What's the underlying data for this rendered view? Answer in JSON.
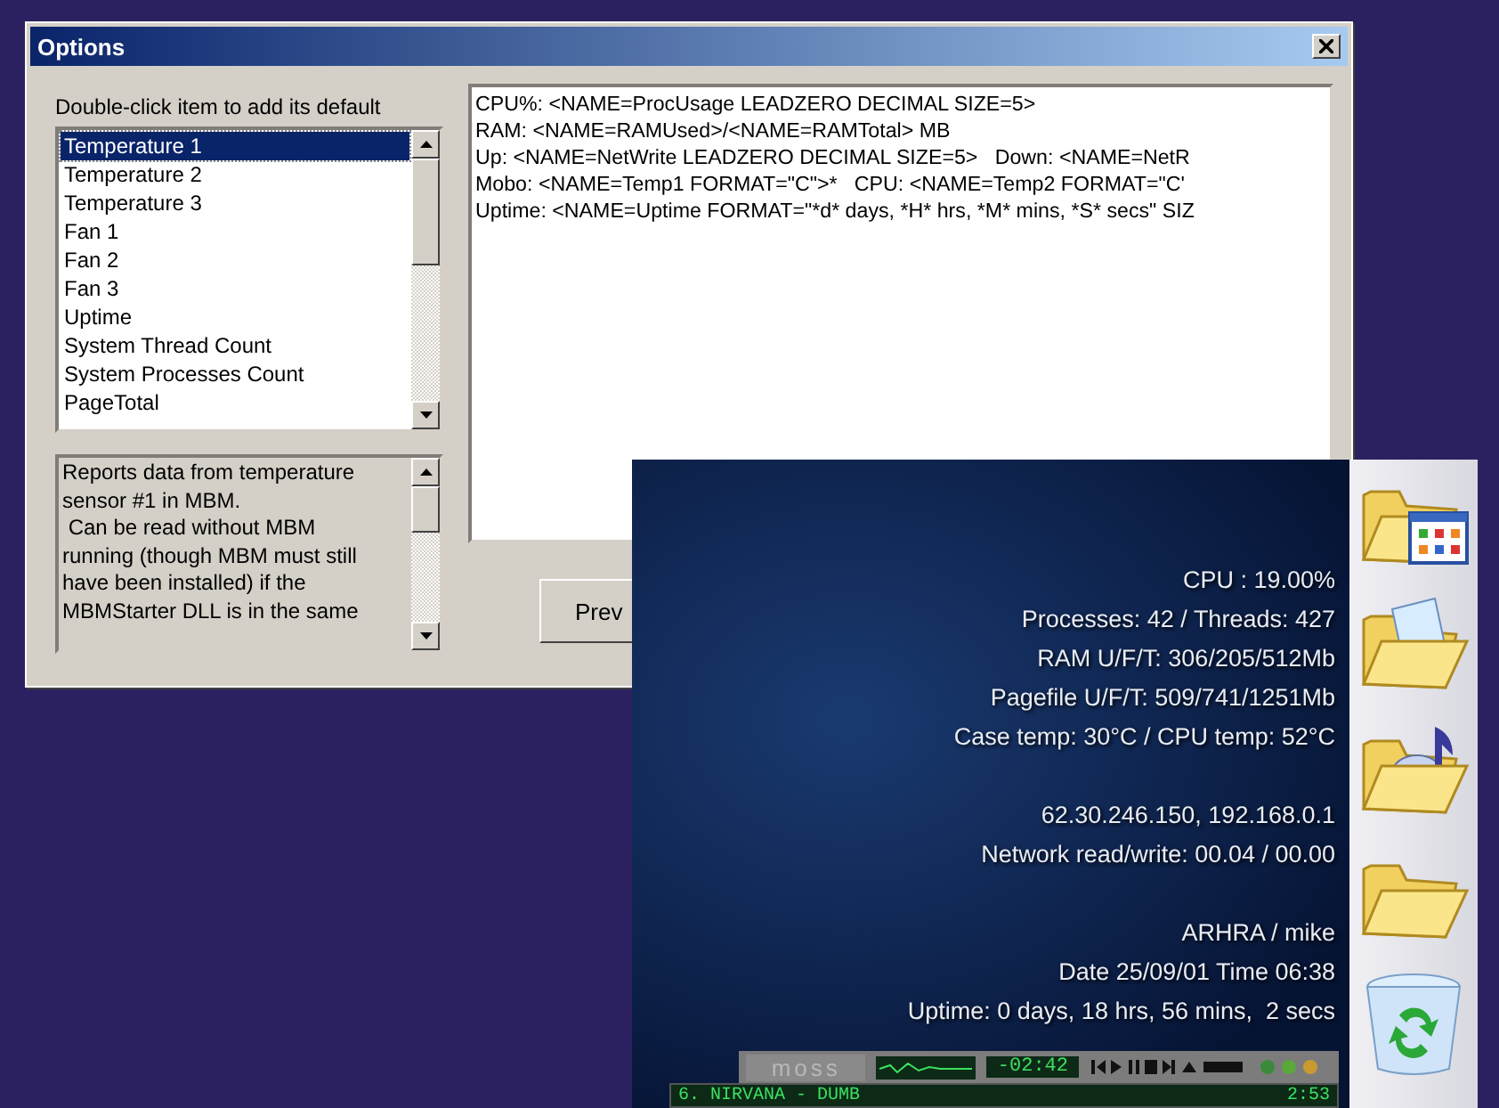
{
  "options_dialog": {
    "title": "Options",
    "list_label": "Double-click item to add its default",
    "items": [
      {
        "label": "Temperature 1",
        "selected": true
      },
      {
        "label": "Temperature 2",
        "selected": false
      },
      {
        "label": "Temperature 3",
        "selected": false
      },
      {
        "label": "Fan 1",
        "selected": false
      },
      {
        "label": "Fan 2",
        "selected": false
      },
      {
        "label": "Fan 3",
        "selected": false
      },
      {
        "label": "Uptime",
        "selected": false
      },
      {
        "label": "System Thread Count",
        "selected": false
      },
      {
        "label": "System Processes Count",
        "selected": false
      },
      {
        "label": "PageTotal",
        "selected": false
      }
    ],
    "description": "Reports data from temperature sensor #1 in MBM.\n Can be read without MBM running (though MBM must still have been installed) if the MBMStarter DLL is in the same",
    "template_lines": [
      "CPU%: <NAME=ProcUsage LEADZERO DECIMAL SIZE=5>",
      "RAM: <NAME=RAMUsed>/<NAME=RAMTotal> MB",
      "Up: <NAME=NetWrite LEADZERO DECIMAL SIZE=5>   Down: <NAME=NetR",
      "Mobo: <NAME=Temp1 FORMAT=\"C\">*   CPU: <NAME=Temp2 FORMAT=\"C'",
      "Uptime: <NAME=Uptime FORMAT=\"*d* days, *H* hrs, *M* mins, *S* secs\" SIZ"
    ],
    "button": "Prev"
  },
  "monitor_overlay": {
    "groups": [
      [
        "CPU : 19.00%",
        "Processes: 42 / Threads: 427",
        "RAM U/F/T: 306/205/512Mb",
        "Pagefile U/F/T: 509/741/1251Mb",
        "Case temp: 30°C / CPU temp: 52°C"
      ],
      [
        "62.30.246.150, 192.168.0.1",
        "Network read/write: 00.04 / 00.00"
      ],
      [
        "ARHRA / mike",
        "Date 25/09/01 Time 06:38",
        "Uptime: 0 days, 18 hrs, 56 mins,  2 secs"
      ]
    ]
  },
  "media_player": {
    "logo": "moss",
    "time": "-02:42",
    "track": "6. NIRVANA - DUMB",
    "track_time": "2:53"
  },
  "desktop_icons": [
    {
      "kind": "folder-window"
    },
    {
      "kind": "folder-document"
    },
    {
      "kind": "folder-music"
    },
    {
      "kind": "folder"
    },
    {
      "kind": "recycle-bin"
    }
  ]
}
